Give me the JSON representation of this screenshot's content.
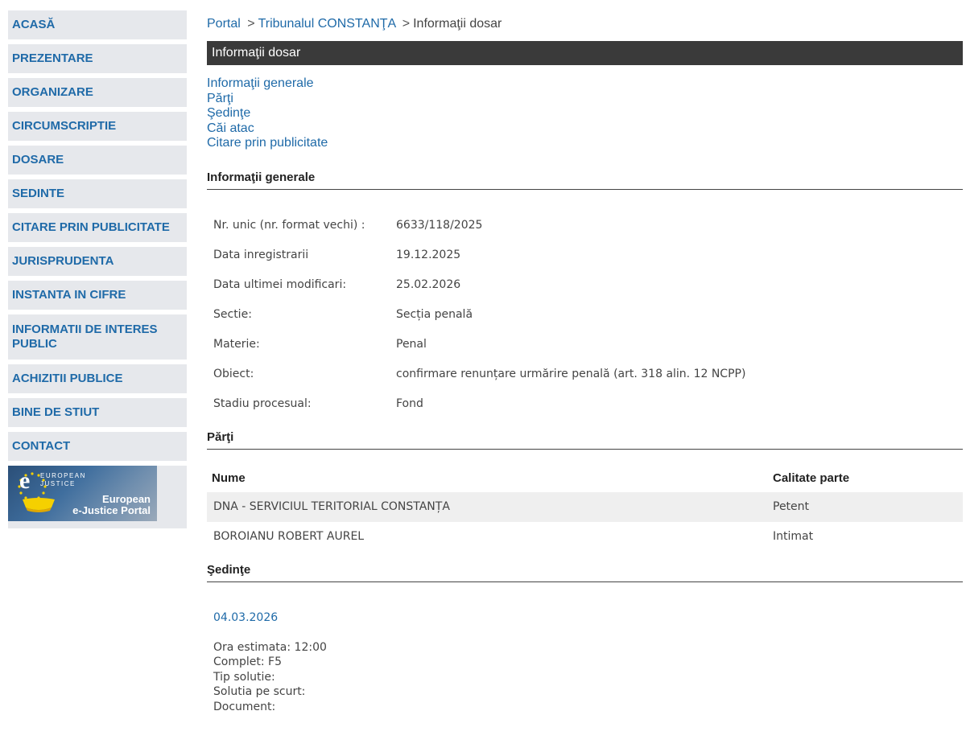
{
  "sidebar": {
    "items": [
      {
        "label": "ACASĂ"
      },
      {
        "label": "PREZENTARE"
      },
      {
        "label": "ORGANIZARE"
      },
      {
        "label": "CIRCUMSCRIPTIE"
      },
      {
        "label": "DOSARE"
      },
      {
        "label": "SEDINTE"
      },
      {
        "label": "CITARE PRIN PUBLICITATE"
      },
      {
        "label": "JURISPRUDENTA"
      },
      {
        "label": "INSTANTA IN CIFRE"
      },
      {
        "label": "INFORMATII DE INTERES PUBLIC"
      },
      {
        "label": "ACHIZITII PUBLICE"
      },
      {
        "label": "BINE DE STIUT"
      },
      {
        "label": "CONTACT"
      }
    ],
    "banner": {
      "euro_line1": "EUROPEAN",
      "euro_line2": "JUSTICE",
      "portal_line1": "European",
      "portal_line2": "e-Justice Portal"
    }
  },
  "breadcrumb": {
    "portal": "Portal",
    "separator": ">",
    "court": "Tribunalul CONSTANŢA",
    "current": "Informaţii dosar"
  },
  "title_bar": "Informaţii dosar",
  "anchors": [
    "Informaţii generale",
    "Părţi",
    "Şedinţe",
    "Căi atac",
    "Citare prin publicitate"
  ],
  "info": {
    "section_title": "Informaţii generale",
    "rows": [
      {
        "label": "Nr. unic (nr. format vechi) :",
        "value": "6633/118/2025"
      },
      {
        "label": "Data inregistrarii",
        "value": "19.12.2025"
      },
      {
        "label": "Data ultimei modificari:",
        "value": "25.02.2026"
      },
      {
        "label": "Sectie:",
        "value": "Secția penală"
      },
      {
        "label": "Materie:",
        "value": "Penal"
      },
      {
        "label": "Obiect:",
        "value": "confirmare renunțare urmărire penală (art. 318 alin. 12 NCPP)"
      },
      {
        "label": "Stadiu procesual:",
        "value": "Fond"
      }
    ]
  },
  "parti": {
    "section_title": "Părţi",
    "header_name": "Nume",
    "header_role": "Calitate parte",
    "rows": [
      {
        "name": "DNA - SERVICIUL TERITORIAL CONSTANȚA",
        "role": "Petent"
      },
      {
        "name": "BOROIANU ROBERT AUREL",
        "role": "Intimat"
      }
    ]
  },
  "sedinte": {
    "section_title": "Şedinţe",
    "date": "04.03.2026",
    "details": [
      "Ora estimata: 12:00",
      "Complet: F5",
      "Tip solutie:",
      "Solutia pe scurt:",
      "Document:"
    ]
  },
  "colors": {
    "link": "#1f6aa8",
    "nav_bg": "#e6e8ec",
    "title_bar_bg": "#3a3a3a",
    "alt_row_bg": "#efefef"
  }
}
